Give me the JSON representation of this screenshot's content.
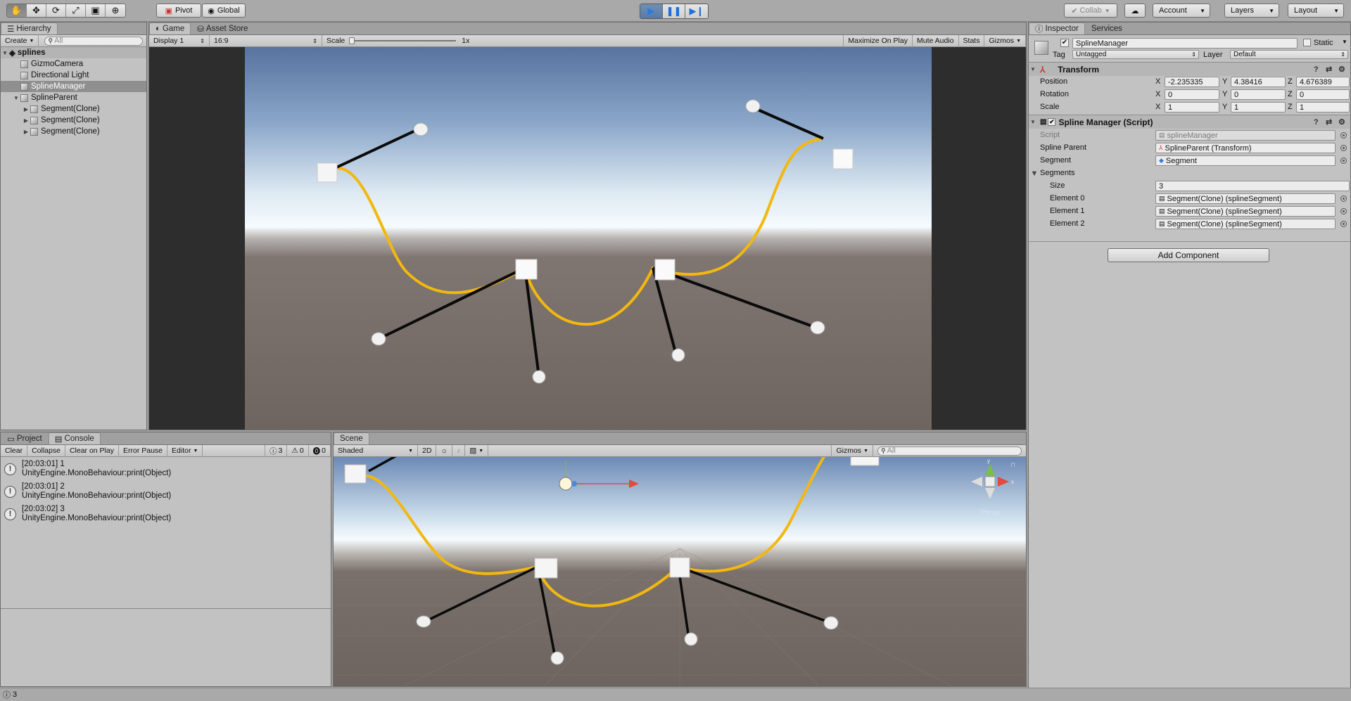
{
  "toolbar": {
    "pivot": "Pivot",
    "global": "Global",
    "collab": "Collab",
    "account": "Account",
    "layers": "Layers",
    "layout": "Layout"
  },
  "hierarchy": {
    "tab": "Hierarchy",
    "create": "Create",
    "search_placeholder": "All",
    "scene": "splines",
    "items": [
      {
        "label": "GizmoCamera"
      },
      {
        "label": "Directional Light"
      },
      {
        "label": "SplineManager"
      },
      {
        "label": "SplineParent"
      },
      {
        "label": "Segment(Clone)"
      },
      {
        "label": "Segment(Clone)"
      },
      {
        "label": "Segment(Clone)"
      }
    ]
  },
  "game": {
    "tab": "Game",
    "asset_store": "Asset Store",
    "display": "Display 1",
    "aspect": "16:9",
    "scale_label": "Scale",
    "scale_value": "1x",
    "maximize": "Maximize On Play",
    "mute": "Mute Audio",
    "stats": "Stats",
    "gizmos": "Gizmos"
  },
  "inspector": {
    "tab": "Inspector",
    "services": "Services",
    "object_name": "SplineManager",
    "static": "Static",
    "tag_label": "Tag",
    "tag_value": "Untagged",
    "layer_label": "Layer",
    "layer_value": "Default",
    "transform": {
      "title": "Transform",
      "position_label": "Position",
      "rotation_label": "Rotation",
      "scale_label": "Scale",
      "position": [
        "-2.235335",
        "4.38416",
        "4.676389"
      ],
      "rotation": [
        "0",
        "0",
        "0"
      ],
      "scale": [
        "1",
        "1",
        "1"
      ]
    },
    "script_comp": {
      "title": "Spline Manager (Script)",
      "script_label": "Script",
      "script_value": "splineManager",
      "spline_parent_label": "Spline Parent",
      "spline_parent_value": "SplineParent (Transform)",
      "segment_label": "Segment",
      "segment_value": "Segment",
      "segments_label": "Segments",
      "size_label": "Size",
      "size_value": "3",
      "elements": [
        {
          "label": "Element 0",
          "value": "Segment(Clone) (splineSegment)"
        },
        {
          "label": "Element 1",
          "value": "Segment(Clone) (splineSegment)"
        },
        {
          "label": "Element 2",
          "value": "Segment(Clone) (splineSegment)"
        }
      ]
    },
    "add_component": "Add Component"
  },
  "console": {
    "project_tab": "Project",
    "console_tab": "Console",
    "clear": "Clear",
    "collapse": "Collapse",
    "clear_on_play": "Clear on Play",
    "error_pause": "Error Pause",
    "editor": "Editor",
    "count_log": "3",
    "count_warn": "0",
    "count_err": "0",
    "entries": [
      {
        "line1": "[20:03:01] 1",
        "line2": "UnityEngine.MonoBehaviour:print(Object)"
      },
      {
        "line1": "[20:03:01] 2",
        "line2": "UnityEngine.MonoBehaviour:print(Object)"
      },
      {
        "line1": "[20:03:02] 3",
        "line2": "UnityEngine.MonoBehaviour:print(Object)"
      }
    ]
  },
  "scene": {
    "tab": "Scene",
    "shaded": "Shaded",
    "two_d": "2D",
    "gizmos": "Gizmos",
    "search_placeholder": "All",
    "persp": "Persp",
    "axis_x": "x",
    "axis_y": "y"
  },
  "statusbar": {
    "text": "3"
  },
  "colors": {
    "spline": "#f2b80f",
    "sky_top": "#5b7aa6",
    "ground": "#736860"
  }
}
